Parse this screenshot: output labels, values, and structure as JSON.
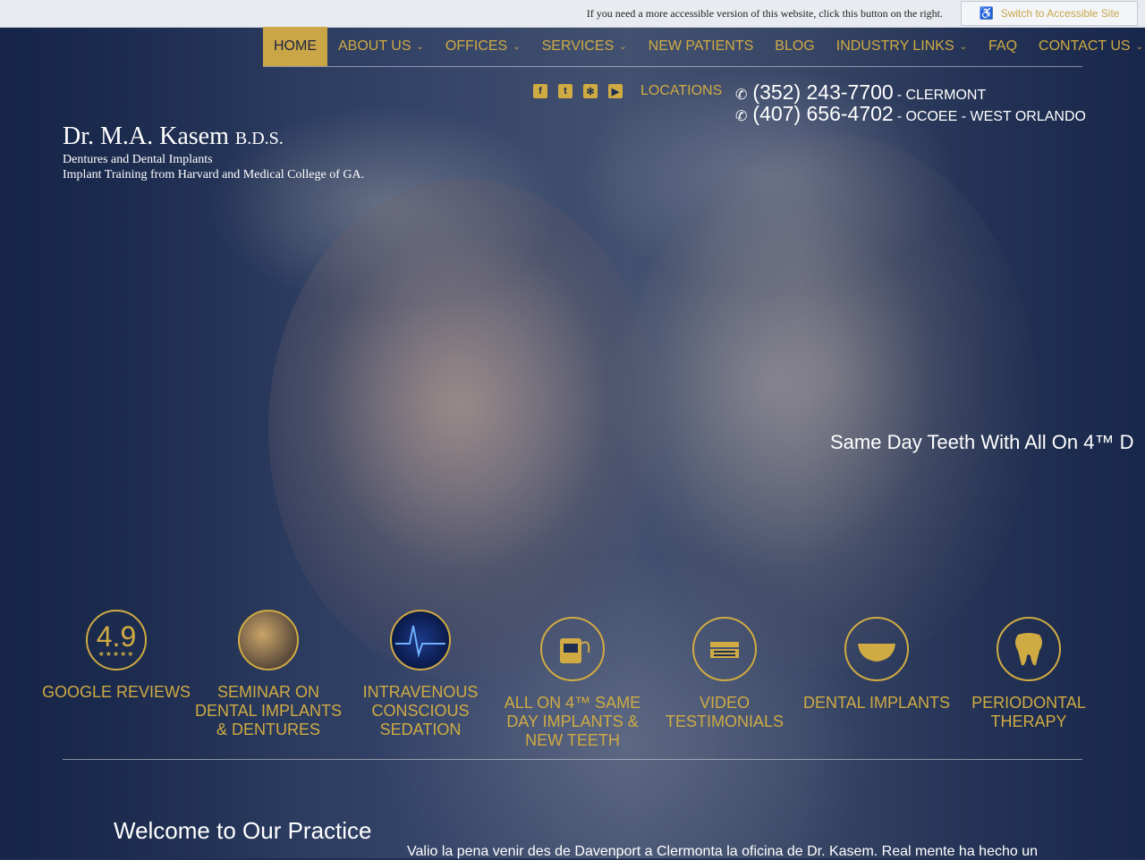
{
  "accessibility": {
    "message": "If you need a more accessible version of this website, click this button on the right.",
    "button_label": "Switch to Accessible Site",
    "icon": "wheelchair-icon"
  },
  "nav": {
    "items": [
      {
        "label": "HOME",
        "active": true,
        "dropdown": false
      },
      {
        "label": "ABOUT US",
        "active": false,
        "dropdown": true
      },
      {
        "label": "OFFICES",
        "active": false,
        "dropdown": true
      },
      {
        "label": "SERVICES",
        "active": false,
        "dropdown": true
      },
      {
        "label": "NEW PATIENTS",
        "active": false,
        "dropdown": false
      },
      {
        "label": "BLOG",
        "active": false,
        "dropdown": false
      },
      {
        "label": "INDUSTRY LINKS",
        "active": false,
        "dropdown": true
      },
      {
        "label": "FAQ",
        "active": false,
        "dropdown": false
      },
      {
        "label": "CONTACT US",
        "active": false,
        "dropdown": true
      }
    ]
  },
  "social": {
    "icons": [
      "facebook-icon",
      "twitter-icon",
      "yelp-icon",
      "youtube-icon"
    ],
    "locations_label": "LOCATIONS"
  },
  "phones": [
    {
      "number": "(352) 243-7700",
      "location": "- CLERMONT"
    },
    {
      "number": "(407) 656-4702",
      "location": "- OCOEE - WEST ORLANDO"
    }
  ],
  "logo": {
    "name": "Dr. M.A. Kasem",
    "suffix": "B.D.S.",
    "line1": "Dentures and Dental Implants",
    "line2": "Implant Training from Harvard and Medical College of GA."
  },
  "hero": {
    "caption": "Same Day Teeth With All On 4™ D"
  },
  "features": [
    {
      "label": "GOOGLE REVIEWS",
      "rating": "4.9",
      "stars": "★★★★★"
    },
    {
      "label": "SEMINAR ON DENTAL IMPLANTS & DENTURES"
    },
    {
      "label": "INTRAVENOUS CONSCIOUS SEDATION"
    },
    {
      "label": "ALL ON 4™ SAME DAY IMPLANTS & NEW TEETH"
    },
    {
      "label": "VIDEO TESTIMONIALS"
    },
    {
      "label": "DENTAL IMPLANTS"
    },
    {
      "label": "PERIODONTAL THERAPY"
    }
  ],
  "welcome": {
    "title": "Welcome to Our Practice",
    "review_snippet": "Valio la pena venir des de Davenport a Clermonta la oficina de Dr. Kasem. Real mente ha hecho un"
  },
  "colors": {
    "accent": "#d0ab43",
    "background": "#1f2f52"
  }
}
